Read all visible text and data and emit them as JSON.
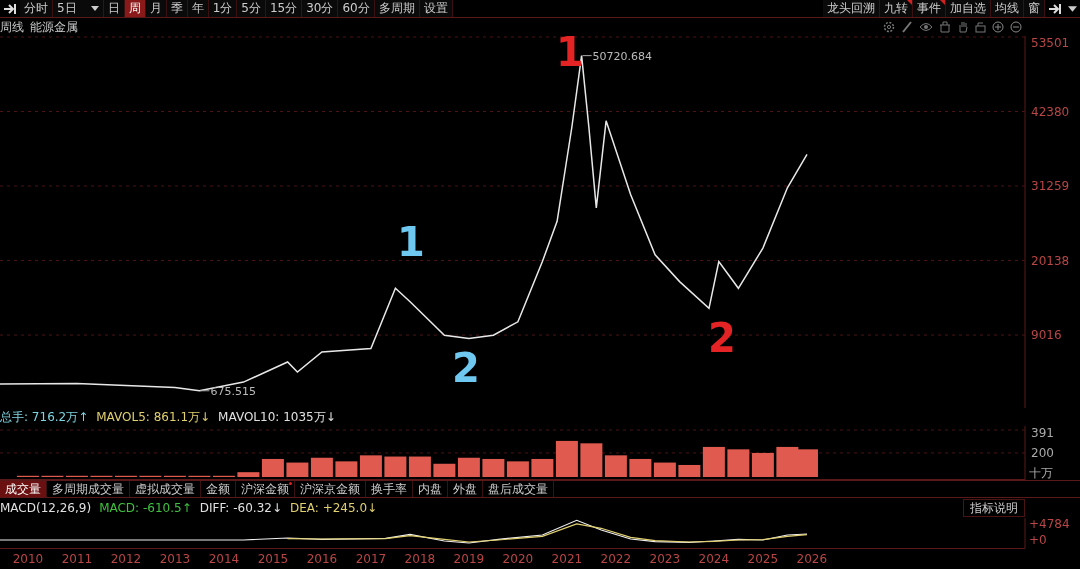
{
  "toolbar": {
    "left": [
      {
        "label": "分时",
        "selected": false,
        "kind": "tab"
      },
      {
        "label": "5日",
        "selected": false,
        "kind": "dropdown"
      },
      {
        "label": "日",
        "selected": false,
        "kind": "tab"
      },
      {
        "label": "周",
        "selected": true,
        "kind": "tab"
      },
      {
        "label": "月",
        "selected": false,
        "kind": "tab"
      },
      {
        "label": "季",
        "selected": false,
        "kind": "tab"
      },
      {
        "label": "年",
        "selected": false,
        "kind": "tab"
      },
      {
        "label": "1分",
        "selected": false,
        "kind": "tab"
      },
      {
        "label": "5分",
        "selected": false,
        "kind": "tab"
      },
      {
        "label": "15分",
        "selected": false,
        "kind": "tab"
      },
      {
        "label": "30分",
        "selected": false,
        "kind": "tab"
      },
      {
        "label": "60分",
        "selected": false,
        "kind": "tab"
      },
      {
        "label": "多周期",
        "selected": false,
        "kind": "tab"
      },
      {
        "label": "设置",
        "selected": false,
        "kind": "tab"
      }
    ],
    "right": [
      {
        "label": "龙头回溯",
        "marked": false
      },
      {
        "label": "九转",
        "marked": true
      },
      {
        "label": "事件",
        "marked": true
      },
      {
        "label": "加自选",
        "marked": false
      },
      {
        "label": "均线",
        "marked": false
      },
      {
        "label": "窗",
        "marked": false
      }
    ]
  },
  "header": {
    "period": "周线",
    "name": "能源金属"
  },
  "price_chart": {
    "chart_data": {
      "type": "line",
      "xlim": [
        2009.43,
        2030.35
      ],
      "ylim": [
        -1872,
        53650
      ],
      "yticks": [
        9016,
        20138,
        31259,
        42380,
        53501
      ],
      "grid": true,
      "series": [
        {
          "color": "#e8e8e8",
          "values": [
            1700,
            1800,
            1500,
            1200,
            700,
            2000,
            5000,
            3500,
            6500,
            7000,
            16000,
            14000,
            9000,
            8500,
            9000,
            11000,
            20000,
            26000,
            40000,
            50720,
            40000,
            28000,
            41000,
            30000,
            21000,
            17000,
            13000,
            20000,
            16000,
            22000,
            31000,
            36000
          ]
        }
      ],
      "x": [
        2009.43,
        2011,
        2012,
        2013,
        2013.5,
        2014.4,
        2015.3,
        2015.5,
        2016,
        2017,
        2017.5,
        2017.8,
        2018.5,
        2019,
        2019.5,
        2020,
        2020.5,
        2020.8,
        2021.1,
        2021.3,
        2021.45,
        2021.6,
        2021.8,
        2022.3,
        2022.8,
        2023.3,
        2023.9,
        2024.1,
        2024.5,
        2025,
        2025.5,
        2025.9
      ],
      "annotations": [
        {
          "text": "50720.684",
          "x": 2021.3,
          "y": 50720
        },
        {
          "text": "675.515",
          "x": 2013.5,
          "y": 700
        }
      ]
    },
    "hand_marks": [
      {
        "text": "1",
        "color": "#e42424"
      },
      {
        "text": "1",
        "color": "#6ec8f0"
      },
      {
        "text": "2",
        "color": "#6ec8f0"
      },
      {
        "text": "2",
        "color": "#e42424"
      }
    ]
  },
  "volume": {
    "legend": [
      {
        "text": "总手: 716.2万↑",
        "color": "#7fd4e0"
      },
      {
        "text": "MAVOL5: 861.1万↓",
        "color": "#e0d070"
      },
      {
        "text": "MAVOL10: 1035万↓",
        "color": "#e0e0e0"
      }
    ],
    "unit": "十万",
    "chart_data": {
      "type": "bar",
      "xlim": [
        2009.43,
        2030.35
      ],
      "ylim": [
        -25,
        424
      ],
      "yticks": [
        200,
        391
      ],
      "x": [
        2010,
        2010.5,
        2011,
        2011.5,
        2012,
        2012.5,
        2013,
        2013.5,
        2014,
        2014.5,
        2015,
        2015.5,
        2016,
        2016.5,
        2017,
        2017.5,
        2018,
        2018.5,
        2019,
        2019.5,
        2020,
        2020.5,
        2021,
        2021.5,
        2022,
        2022.5,
        2023,
        2023.5,
        2024,
        2024.5,
        2025,
        2025.5,
        2025.9
      ],
      "grid": true,
      "series": [
        {
          "color": "#e05a50",
          "values": [
            10,
            10,
            10,
            10,
            10,
            10,
            10,
            10,
            10,
            40,
            150,
            120,
            160,
            130,
            180,
            170,
            170,
            110,
            160,
            150,
            130,
            150,
            300,
            280,
            180,
            150,
            120,
            100,
            250,
            230,
            200,
            250,
            230
          ]
        }
      ]
    }
  },
  "tabs": [
    {
      "label": "成交量",
      "selected": true,
      "marked": false
    },
    {
      "label": "多周期成交量",
      "selected": false,
      "marked": false
    },
    {
      "label": "虚拟成交量",
      "selected": false,
      "marked": false
    },
    {
      "label": "金额",
      "selected": false,
      "marked": false
    },
    {
      "label": "沪深金额",
      "selected": false,
      "marked": true
    },
    {
      "label": "沪深京金额",
      "selected": false,
      "marked": false
    },
    {
      "label": "换手率",
      "selected": false,
      "marked": false
    },
    {
      "label": "内盘",
      "selected": false,
      "marked": false
    },
    {
      "label": "外盘",
      "selected": false,
      "marked": false
    },
    {
      "label": "盘后成交量",
      "selected": false,
      "marked": false
    }
  ],
  "macd": {
    "legend": [
      {
        "text": "MACD(12,26,9)",
        "color": "#e0e0e0"
      },
      {
        "text": "MACD: -610.5↑",
        "color": "#40c040"
      },
      {
        "text": "DIFF: -60.32↓",
        "color": "#e0e0e0"
      },
      {
        "text": "DEA: +245.0↓",
        "color": "#e0d070"
      }
    ],
    "help_button": "指标说明",
    "chart_data": {
      "type": "line",
      "xlim": [
        2009.43,
        2030.35
      ],
      "ylim": [
        -2392,
        6578
      ],
      "yticks": [
        {
          "value": 0,
          "label": "+0"
        },
        {
          "value": 4784,
          "label": "+4784"
        }
      ],
      "x": [
        2009.43,
        2014.4,
        2015.3,
        2016,
        2017.3,
        2017.8,
        2018.5,
        2019,
        2019.6,
        2020.5,
        2021.2,
        2021.7,
        2022.3,
        2022.8,
        2023.5,
        2024,
        2024.5,
        2025,
        2025.5,
        2025.9
      ],
      "xticks": [
        2010,
        2011,
        2012,
        2013,
        2014,
        2015,
        2016,
        2017,
        2018,
        2019,
        2020,
        2021,
        2022,
        2023,
        2024,
        2025,
        2026
      ],
      "series": [
        {
          "color": "#f0f0f0",
          "values": [
            0,
            0,
            600,
            200,
            500,
            1700,
            -300,
            -900,
            200,
            1500,
            5900,
            3000,
            300,
            -500,
            -700,
            -300,
            200,
            0,
            1500,
            1800
          ]
        },
        {
          "color": "#e0d070",
          "values": [
            null,
            null,
            400,
            300,
            400,
            1300,
            200,
            -600,
            0,
            1100,
            4800,
            3500,
            800,
            -200,
            -600,
            -400,
            0,
            100,
            1100,
            1600
          ]
        }
      ]
    }
  }
}
